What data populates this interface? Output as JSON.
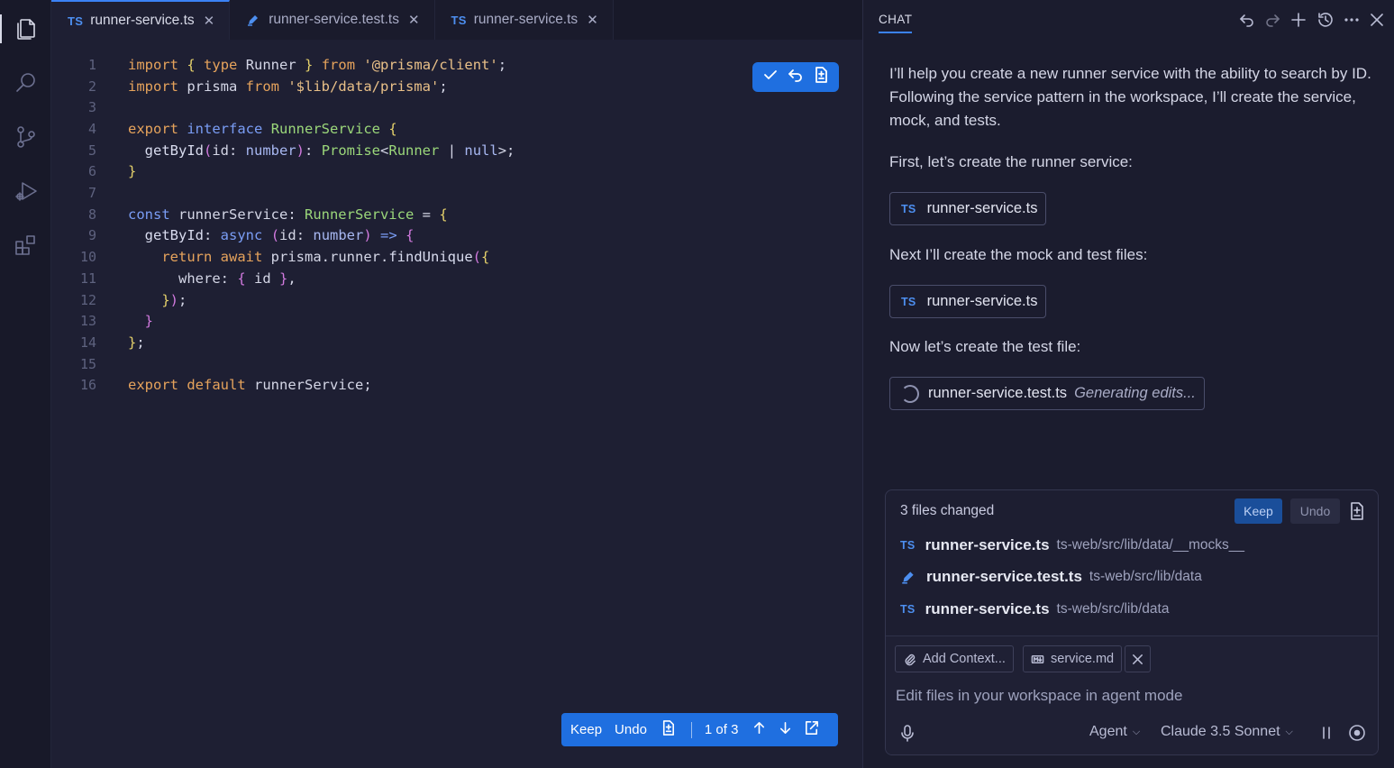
{
  "activity_bar": {
    "items": [
      {
        "name": "explorer-icon"
      },
      {
        "name": "search-icon"
      },
      {
        "name": "source-control-icon"
      },
      {
        "name": "run-debug-icon"
      },
      {
        "name": "extensions-icon"
      }
    ]
  },
  "editor": {
    "tabs": [
      {
        "badge": "TS",
        "label": "runner-service.ts",
        "active": true
      },
      {
        "badge": "pen",
        "label": "runner-service.test.ts",
        "active": false
      },
      {
        "badge": "TS",
        "label": "runner-service.ts",
        "active": false
      }
    ],
    "line_numbers": [
      "1",
      "2",
      "3",
      "4",
      "5",
      "6",
      "7",
      "8",
      "9",
      "10",
      "11",
      "12",
      "13",
      "14",
      "15",
      "16"
    ],
    "review_bar": {
      "keep": "Keep",
      "undo": "Undo",
      "position": "1 of 3"
    }
  },
  "chat": {
    "title": "CHAT",
    "messages": [
      "I’ll help you create a new runner service with the ability to search by ID. Following the service pattern in the workspace, I’ll create the service, mock, and tests.",
      "First, let’s create the runner service:",
      "Next I’ll create the mock and test files:",
      "Now let’s create the test file:"
    ],
    "file_chips": [
      {
        "badge": "TS",
        "label": "runner-service.ts"
      },
      {
        "badge": "TS",
        "label": "runner-service.ts"
      },
      {
        "label": "runner-service.test.ts",
        "status": "Generating edits..."
      }
    ],
    "changes": {
      "summary": "3 files changed",
      "keep": "Keep",
      "undo": "Undo",
      "files": [
        {
          "badge": "TS",
          "name": "runner-service.ts",
          "path": "ts-web/src/lib/data/__mocks__"
        },
        {
          "badge": "pen",
          "name": "runner-service.test.ts",
          "path": "ts-web/src/lib/data"
        },
        {
          "badge": "TS",
          "name": "runner-service.ts",
          "path": "ts-web/src/lib/data"
        }
      ]
    },
    "input": {
      "add_context": "Add Context...",
      "attached_file": "service.md",
      "placeholder": "Edit files in your workspace in agent mode",
      "mode": "Agent",
      "model": "Claude 3.5 Sonnet"
    }
  },
  "colors": {
    "accent": "#1f6fe0",
    "background": "#1b1c2e",
    "editor_background": "#1e1f33",
    "ts_badge": "#4d8ff0"
  }
}
